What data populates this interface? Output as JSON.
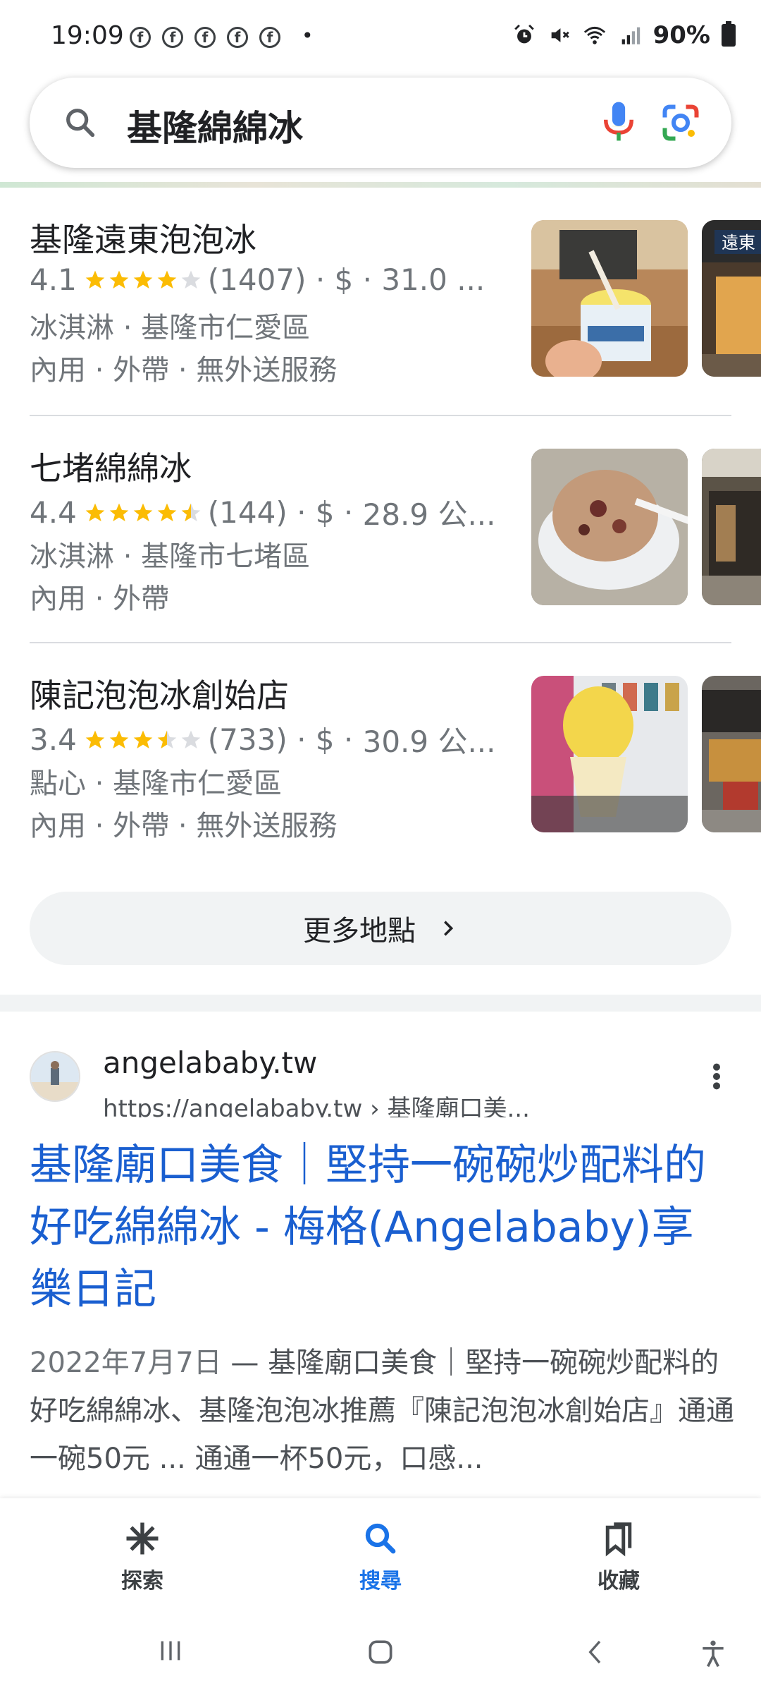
{
  "status_bar": {
    "time": "19:09",
    "fb_icons": [
      "f",
      "f",
      "f",
      "f",
      "f"
    ],
    "dot": "•",
    "battery": "90%"
  },
  "search": {
    "query": "基隆綿綿冰"
  },
  "places": [
    {
      "name": "基隆遠東泡泡冰",
      "rating": "4.1",
      "stars": 4,
      "reviews": "(1407)",
      "price": "$",
      "distance": "31.0 ...",
      "category_area": "冰淇淋 · 基隆市仁愛區",
      "services": "內用 · 外帶 · 無外送服務",
      "thumb_text": "遠東"
    },
    {
      "name": "七堵綿綿冰",
      "rating": "4.4",
      "stars": 4.5,
      "reviews": "(144)",
      "price": "$",
      "distance": "28.9 公...",
      "category_area": "冰淇淋 · 基隆市七堵區",
      "services": "內用 · 外帶",
      "thumb_text": ""
    },
    {
      "name": "陳記泡泡冰創始店",
      "rating": "3.4",
      "stars": 3.5,
      "reviews": "(733)",
      "price": "$",
      "distance": "30.9 公...",
      "category_area": "點心 · 基隆市仁愛區",
      "services": "內用 · 外帶 · 無外送服務",
      "thumb_text": ""
    }
  ],
  "more_places": "更多地點",
  "result": {
    "site_name": "angelababy.tw",
    "url": "https://angelababy.tw › 基隆廟口美...",
    "title": "基隆廟口美食｜堅持一碗碗炒配料的好吃綿綿冰 - 梅格(Angelababy)享樂日記",
    "date": "2022年7月7日",
    "snippet": " — 基隆廟口美食｜堅持一碗碗炒配料的好吃綿綿冰、基隆泡泡冰推薦『陳記泡泡冰創始店』通通一碗50元 ... 通通一杯50元，口感..."
  },
  "bottom_nav": {
    "explore": "探索",
    "search": "搜尋",
    "saved": "收藏"
  },
  "colors": {
    "link_blue": "#1a5fd0",
    "star": "#fbbc04",
    "active": "#1a73e8"
  }
}
